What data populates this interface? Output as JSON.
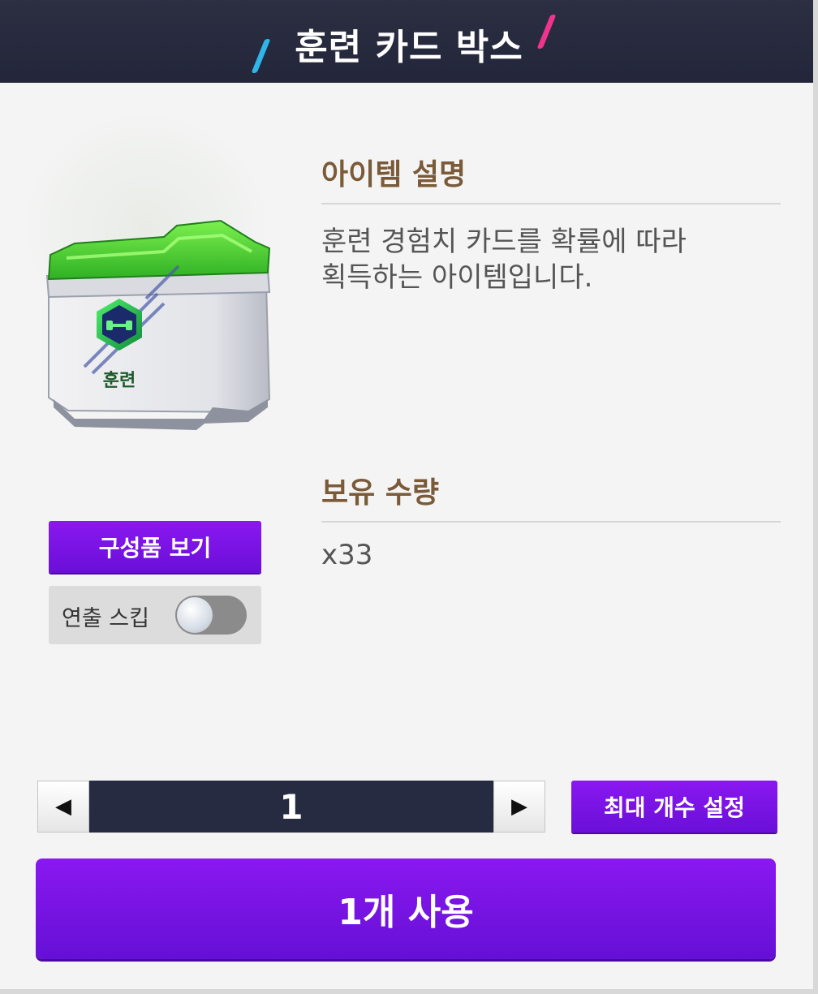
{
  "header": {
    "title": "훈련 카드 박스"
  },
  "item": {
    "box_label": "훈련",
    "description_heading": "아이템 설명",
    "description_lines": [
      "훈련 경험치 카드를 확률에 따라",
      "획득하는 아이템입니다."
    ],
    "quantity_heading": "보유 수량",
    "quantity_value": "x33"
  },
  "actions": {
    "compose_label": "구성품 보기",
    "skip_label": "연출 스킵",
    "skip_enabled": false,
    "stepper_value": "1",
    "stepper_left_icon": "◀",
    "stepper_right_icon": "▶",
    "max_label": "최대 개수 설정",
    "use_label": "1개 사용"
  },
  "colors": {
    "accent_purple": "#7a14e6",
    "header_bg": "#262a3e",
    "heading_brown": "#7a5a38",
    "slash_blue": "#2fb6e9",
    "slash_pink": "#f0348e"
  }
}
